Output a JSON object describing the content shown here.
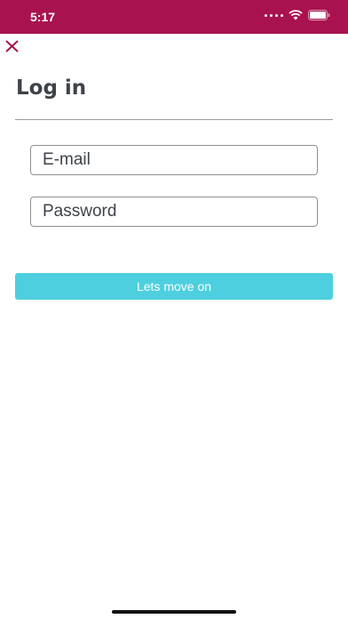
{
  "status_bar": {
    "time": "5:17",
    "color": "#a8134f",
    "icons": [
      "signal-dots-icon",
      "wifi-icon",
      "battery-icon"
    ]
  },
  "header": {
    "close_icon": "close-icon",
    "title": "Log in"
  },
  "form": {
    "email_placeholder": "E-mail",
    "email_value": "",
    "password_placeholder": "Password",
    "password_value": "",
    "submit_label": "Lets move on"
  },
  "colors": {
    "accent": "#a8134f",
    "button": "#4ecfdf",
    "text": "#3e434a"
  }
}
